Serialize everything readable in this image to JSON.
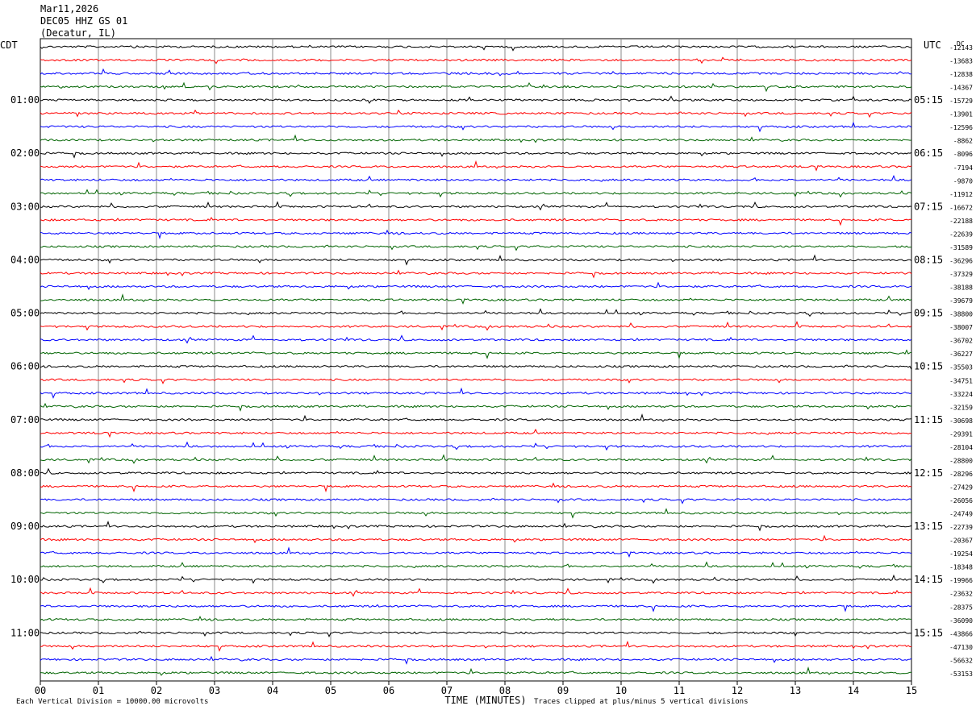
{
  "header": {
    "date": "Mar11,2026",
    "station": "DEC05 HHZ GS 01",
    "location": "(Decatur, IL)"
  },
  "footer": {
    "scale_note": "Each Vertical Division = 10000.00 microvolts",
    "clip_note": "Traces clipped at plus/minus 5 vertical divisions"
  },
  "chart_data": {
    "type": "line",
    "title": "",
    "xlabel": "TIME (MINUTES)",
    "ylabel": "",
    "xlim": [
      0,
      15
    ],
    "x_ticks": [
      "00",
      "01",
      "02",
      "03",
      "04",
      "05",
      "06",
      "07",
      "08",
      "09",
      "10",
      "11",
      "12",
      "13",
      "14",
      "15"
    ],
    "left_axis_label": "CDT",
    "right_axis_label": "UTC",
    "right_top_label": "DC",
    "left_hour_labels": [
      "01:00",
      "02:00",
      "03:00",
      "04:00",
      "05:00",
      "06:00",
      "07:00",
      "08:00",
      "09:00",
      "10:00",
      "11:00"
    ],
    "right_hour_labels": [
      "05:15",
      "06:15",
      "07:15",
      "08:15",
      "09:15",
      "10:15",
      "11:15",
      "12:15",
      "13:15",
      "14:15",
      "15:15"
    ],
    "trace_colors": [
      "#000000",
      "#ff0000",
      "#0000ff",
      "#006400"
    ],
    "trace_offsets": [
      "-12143",
      "-13683",
      "-12838",
      "-14367",
      "-15729",
      "-13901",
      "-12596",
      "-8862",
      "-8096",
      "-7194",
      "-9870",
      "-11912",
      "-16672",
      "-22188",
      "-22639",
      "-31589",
      "-36296",
      "-37329",
      "-38188",
      "-39679",
      "-38800",
      "-38007",
      "-36702",
      "-36227",
      "-35503",
      "-34751",
      "-33224",
      "-32159",
      "-30698",
      "-29391",
      "-28104",
      "-28800",
      "-28296",
      "-27429",
      "-26056",
      "-24749",
      "-22739",
      "-20367",
      "-19254",
      "-18348",
      "-19966",
      "-23632",
      "-28375",
      "-36090",
      "-43866",
      "-47130",
      "-56632",
      "-53153"
    ],
    "grid": true
  }
}
